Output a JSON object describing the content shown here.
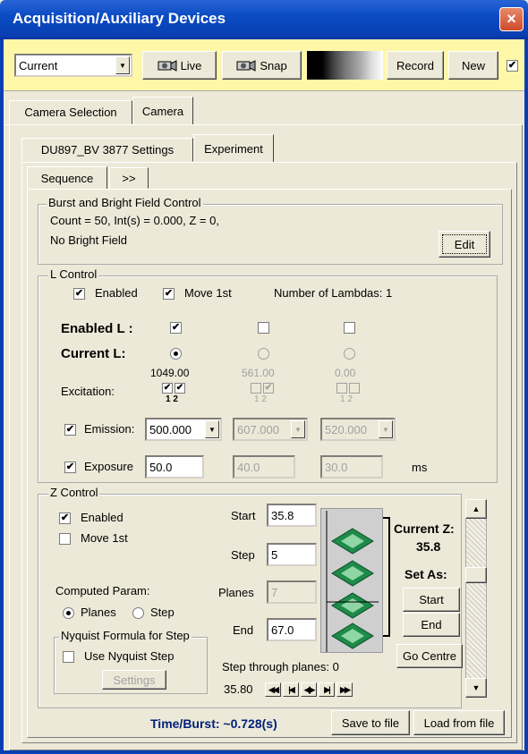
{
  "window": {
    "title": "Acquisition/Auxiliary Devices",
    "close": "×"
  },
  "toolbar": {
    "mode_value": "Current",
    "live_label": "Live",
    "snap_label": "Snap",
    "record_label": "Record",
    "new_label": "New",
    "new_checked": "✔"
  },
  "tabs": {
    "camera_selection": "Camera Selection",
    "camera": "Camera"
  },
  "subtabs": {
    "settings": "DU897_BV 3877 Settings",
    "experiment": "Experiment"
  },
  "seqtabs": {
    "sequence": "Sequence",
    "more": ">>"
  },
  "burst": {
    "legend": "Burst and Bright Field Control",
    "line1": "Count = 50, Int(s) = 0.000, Z = 0,",
    "line2": "No Bright Field",
    "edit_label": "Edit"
  },
  "lcontrol": {
    "legend": "L Control",
    "enabled_label": "Enabled",
    "move1st_label": "Move 1st",
    "num_lambdas": "Number of Lambdas:  1",
    "enabled_l_label": "Enabled L :",
    "current_l_label": "Current L:",
    "excitation_label": "Excitation:",
    "exc_values": [
      "1049.00",
      "561.00",
      "0.00"
    ],
    "exc_sub": "1  2",
    "emission_label": "Emission:",
    "emission_values": [
      "500.000",
      "607.000",
      "520.000"
    ],
    "exposure_label": "Exposure",
    "exposure_values": [
      "50.0",
      "40.0",
      "30.0"
    ],
    "exposure_unit": "ms",
    "check_mark": "✔"
  },
  "zcontrol": {
    "legend": "Z Control",
    "enabled_label": "Enabled",
    "move1st_label": "Move 1st",
    "start_label": "Start",
    "start_value": "35.8",
    "step_label": "Step",
    "step_value": "5",
    "planes_label": "Planes",
    "planes_value": "7",
    "end_label": "End",
    "end_value": "67.0",
    "current_z_label": "Current Z:",
    "current_z_value": "35.8",
    "set_as_label": "Set As:",
    "set_start_label": "Start",
    "set_end_label": "End",
    "go_centre_label": "Go Centre",
    "computed_param_label": "Computed Param:",
    "planes_radio_label": "Planes",
    "step_radio_label": "Step",
    "nyquist_legend": "Nyquist Formula for Step",
    "use_nyquist_label": "Use Nyquist Step",
    "settings_label": "Settings",
    "step_through_label": "Step through planes:  0",
    "step_through_pos": "35.80"
  },
  "footer": {
    "time_burst": "Time/Burst: ~0.728(s)",
    "save_label": "Save to file",
    "load_label": "Load from file"
  },
  "colors": {
    "toolbar_bg": "#fff7a8",
    "title_blue": "#0a4bc4",
    "time_text": "#00207a"
  }
}
